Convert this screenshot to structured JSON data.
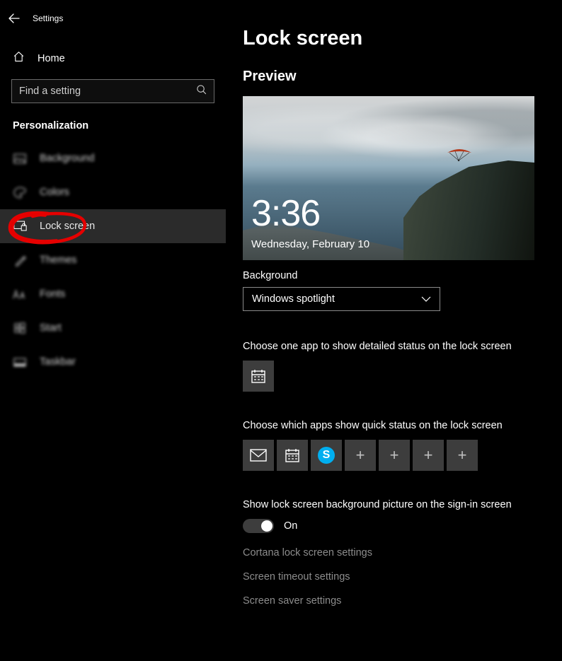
{
  "window": {
    "title": "Settings"
  },
  "sidebar": {
    "home": "Home",
    "search_placeholder": "Find a setting",
    "category": "Personalization",
    "items": [
      {
        "label": "Background"
      },
      {
        "label": "Colors"
      },
      {
        "label": "Lock screen"
      },
      {
        "label": "Themes"
      },
      {
        "label": "Fonts"
      },
      {
        "label": "Start"
      },
      {
        "label": "Taskbar"
      }
    ]
  },
  "main": {
    "title": "Lock screen",
    "preview_header": "Preview",
    "preview_time": "3:36",
    "preview_date": "Wednesday, February 10",
    "bg_label": "Background",
    "bg_value": "Windows spotlight",
    "detailed_status_text": "Choose one app to show detailed status on the lock screen",
    "quick_status_text": "Choose which apps show quick status on the lock screen",
    "signin_text": "Show lock screen background picture on the sign-in screen",
    "toggle_state": "On",
    "links": [
      "Cortana lock screen settings",
      "Screen timeout settings",
      "Screen saver settings"
    ]
  }
}
